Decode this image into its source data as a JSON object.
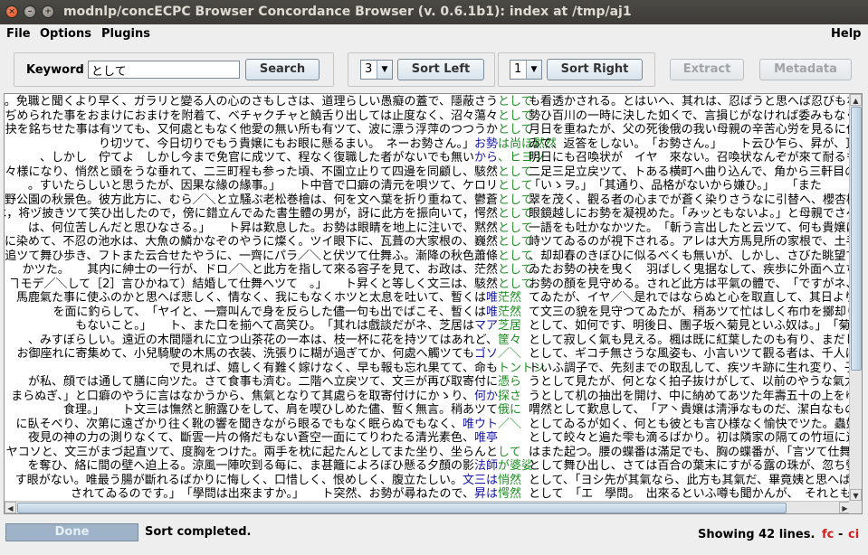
{
  "window": {
    "title": "modnlp/concECPC Browser Concordance Browser (v. 0.6.1b1): index at /tmp/aj1",
    "close": "×",
    "minimize": "–",
    "maximize": "+"
  },
  "menu": {
    "file": "File",
    "options": "Options",
    "plugins": "Plugins",
    "help": "Help"
  },
  "toolbar": {
    "keyword_label": "Keyword",
    "keyword_value": "として",
    "search_label": "Search",
    "left_context": "3",
    "sort_left_label": "Sort Left",
    "right_context": "1",
    "sort_right_label": "Sort Right",
    "extract_label": "Extract",
    "metadata_label": "Metadata",
    "dropdown_arrow": "▼"
  },
  "scroll": {
    "up": "▲",
    "down": "▼",
    "left": "◀",
    "right": "▶"
  },
  "concordance": [
    {
      "left": "る。免職と聞くより早く、ガラリと變る人の心のさもしさは、道理らしい愚癡の蓋で、隱蔽さう",
      "hl": "",
      "kw": "として",
      "right": "も看透かされる。とはいへ、其れは、忍ばうと思へば忍びもならうが、"
    },
    {
      "left": "いぢめられた事をおまけにおまけを附着て、ベチャクチャと饒舌り出しては止度なく、沼々蕩々",
      "hl": "",
      "kw": "として",
      "right": "勢ひ百川の一時に決した如くで、言損じがなければ委みもなく、多年の"
    },
    {
      "left": "に抉を銘ちせた事は有ツても、又何處ともなく他愛の無い所も有ツて、波に漂う浮萍のつつうか",
      "hl": "",
      "kw": "として",
      "right": "月日を重ねたが、父の死後俄の我い母親の辛苦心労を見るに付け聞くに"
    },
    {
      "left": "り切ツて、今日切りでもう貴嬢にもお眼に懸るまい。　ネーお勢さん。」",
      "hl": "お勢",
      "kw": "は尚ほ黙然",
      "right": "ゐて、返答をしない。　「お勢さん。」　　ト云ひ乍ら、昇が、頂"
    },
    {
      "left": "、しかし　佇てよ　しかし今まで免官に成ツて、程なく復職した者がないでも無い",
      "hl": "から",
      "kw": "、ヒヨツ",
      "right": "明日にも召喚状が　イヤ　來ない。召喚状なんぞが來て耐るものか。よ"
    },
    {
      "left": "は忌々様になり、悄然と頭をうな垂れて、二三町程も参った頃、不園立止りて四邊を同顧し、駭然",
      "hl": "",
      "kw": "として",
      "right": "二足三足立戻ツて、トある横町へ曲り込んで、角から三軒目の格子戸作"
    },
    {
      "left": "。すいたらしいと思うたが、因果な緣の緣事。」　　ト中音で口癖の清元を唄ツて、ケロリ",
      "hl": "",
      "kw": "として",
      "right": "「いゝヲ。」　「其通り、品格がないから嫌ひ。」　　「また"
    },
    {
      "left": "上野公園の秋景色。彼方此方に、むら／＼と立騒ぶ老松巻檜は、何を文へ葉を折り重ねて、鬱蒼",
      "hl": "",
      "kw": "として",
      "right": "翠を茂く、觀る者の心までが蒼く染りさうなに引替へ、櫻杏桃李の雜木"
    },
    {
      "left": "には，将ヅ披きツて笑ひ出したので，傍に錯立んでゐた書生體の男が，訝に此方を振向いて，愕然",
      "hl": "",
      "kw": "として",
      "right": "眼鏡越しにお勢を凝視めた。「みッともないよ。」と母親でさへ小言を"
    },
    {
      "left": "は、何位苦しんだと思ひなさる。」　　ト昇は歎息した。お勢は眼睛を地上に注いで、黙然",
      "hl": "",
      "kw": "として",
      "right": "一語をも吐かなかツた。　「斬う言出したと云ツて、何も貴嬢に義"
    },
    {
      "left": "済に染めて、不忍の池水は、大魚の鱗かなぞのやうに燦く。ツイ眼下に、瓦葺の大家根の、巍然",
      "hl": "",
      "kw": "として",
      "right": "峙ツてゐるのが視下される。アレは大方馬見所の家根で、土手に隱れて"
    },
    {
      "left": "を追ツて舞ひ歩き、フトまた云合せたやうに、一齊にパラ／＼と伏ツて仕舞ふ。漸降の秋色蕭條",
      "hl": "",
      "kw": "として",
      "right": "、却却春のきぼひに似るべくも無いが、しかし、さびた眺望で、また一"
    },
    {
      "left": "かツた。　　其内に紳士の一行が、ドロ／＼と此方を指して來る容子を見て、お政は、茫然",
      "hl": "",
      "kw": "として",
      "right": "ゐたお勢の袂を曳く　羽ばしく鬼据なして、疾歩に外面へ立ち出で、路傍に佇"
    },
    {
      "left": "ヿモデ／＼して［2］言ひかねて）結婚して仕舞へツて　。」　　ト昇くと等しく文三は、駭然",
      "hl": "",
      "kw": "として",
      "right": "お勢の顏を見守める。されど此方は平氣の體で、　「ですがネ、教育"
    },
    {
      "left": "馬鹿氣た事に使ふのかと思へば悲しく、情なく、我にもなくホツと太息を吐いて、暫くは",
      "hl": "唯",
      "kw": "茫然",
      "right": "てゐたが、イヤ／＼是れではならぬと心を取直して、其日より事務に取掛"
    },
    {
      "left": "を面に釣らして、　「ヤイと、一齋叫んで身を反らした儘一句も出でばこそ、暫くは",
      "hl": "唯",
      "kw": "茫然",
      "right": "て文三の貌を見守つてゐたが、稍あツて忙はしく布巾を擲却り出して、小"
    },
    {
      "left": "もないこと。」　　ト、また口を揃へて高笑ひ。　「其れは戲談だがネ、芝居は",
      "hl": "マア",
      "kw": "芝居",
      "right": "として、如何です、明後日、團子坂へ菊見といふ奴は。」　「菊見、左様さ"
    },
    {
      "left": "、みすぼらしい。遠近の木間隱れに立つ山茶花の一本は、枝一杯に花を持ツてはあれど、",
      "hl": "",
      "kw": "筐々",
      "right": "として寂しく氣も見える。楓は既に紅葉したのも有り、まだしないのも有る"
    },
    {
      "left": "お御座れに寄集めて、小兒騎駛の木馬の衣装、洗張りに糊が過ぎてか、何處へ觸ツても",
      "hl": "ゴソ",
      "kw": "／＼",
      "right": "として、ギコチ無さうな風姿も、小言いツて觀る者は、千人に一人か二人"
    },
    {
      "left": "で見れば、嬉しく有難く嫁けなく、早も報も忘れ果てて、命も",
      "hl": "",
      "kw": "トントン",
      "right": "トいふ調子で、先刻までの取乱して、疾ツキ跡に生れ変り、子を物して"
    },
    {
      "left": "が私、顔では通して膳に向ツた。さて食事も濟む。二階へ立戻ツて、文三が再び取寄付に",
      "hl": "",
      "kw": "憑ら",
      "right": "うとして見たが、何となく拍子抜けがして、以前のやうな氣力が出ない。ソツと"
    },
    {
      "left": "まらぬぎ、」と口癖のやうに言はなかうから、焦氣となりて其處らを取寄付けにかゝり、",
      "hl": "何か",
      "kw": "探さ",
      "right": "うとして机の抽出を開け、中に納めてあツた年壽五十の上をゆく白髪たる老婦の"
    },
    {
      "left": "食理。」　　ト文三は憮然と腑露ひをして、肩を喫ひしめた儘、暫く無言。稍あツて",
      "hl": "",
      "kw": "俄に",
      "right": "喟然として歎息して、　「ア丶貴嬢は淸淨なものだ、潔白なものだ。　親よりも"
    },
    {
      "left": "に臥そべり、次第に遠ざかり往く靴の響を聞きながら眼るでもなく眠らぬでもなく、",
      "hl": "唯ウト",
      "kw": "／＼",
      "right": "としてゐるが如く、何とも彼とも言ひ様なく愉快でツた。蟲奴は何時の間にか太"
    },
    {
      "left": "夜見の神の力の測りなくて、斷雲一片の脩だもない蒼空一面にてりわたる清光素色、",
      "hl": "唯亭",
      "kw": "",
      "right": "として皎々と遍た雫も滴るばかり。初は隣家の隔ての竹垣に遮られて庭の半より這朝の"
    },
    {
      "left": "リヤコソと、文三がまづ起直ツて、度胸をつけた。兩手を枕に起たんとしてまた坐り、坐らんと",
      "hl": "",
      "kw": "して",
      "right": "はまた起つ。腰の蝶番は滿足でも、胸の蝶番が、「言ツて仕舞はうか"
    },
    {
      "left": "を奪ひ、絡に間の壁へ迫上る。涼風一陣吹到る每に、ま甚籬によろぼひ懸る夕顏の影",
      "hl": "法師",
      "kw": "が婆娑",
      "right": "として舞ひ出し、さては百合の葉末にすがる露の珠が、忽ち螢と成ツて飛迷ふ"
    },
    {
      "left": "す眼がない。唯最う腸が斷れるばかりに悔しく、口惜しく、恨めしく、腹立たしい。",
      "hl": "文三は",
      "kw": "悄然",
      "right": "として、「ヨシ先が其氣なら、此方も其氣だ、畢竟姨と思へばこそ、獣と思"
    },
    {
      "left": "されてゐるのです。」　「學問は出來ますか。」　　ト突然、お勢が尋ねたので、",
      "hl": "昇は",
      "kw": "愕然",
      "right": "として　「エ　學問。　出來るといふ噂も聞かんが、　それとも出來ま"
    },
    {
      "left": "かけツて、急に袖で口を掩ひ、額越に昇の貌を眺めて眼元で笑ツた。 身に餘る面目に、",
      "hl": "昇は",
      "kw": "得々",
      "right": "として滿面に笑ひを含ませ、紳士の笑ひ罷むを待ツて、また何か饒舌り出"
    }
  ],
  "status": {
    "progress_label": "Done",
    "progress": 1.0,
    "message": "Sort completed.",
    "lines": "Showing 42 lines.",
    "fc": "fc",
    "dash": "-",
    "ci": "ci"
  },
  "colors": {
    "keyword": "#1d8d22",
    "highlight": "#1515a8",
    "fc_ci": "#d11f1f",
    "titlebar": "#3c3b37"
  }
}
